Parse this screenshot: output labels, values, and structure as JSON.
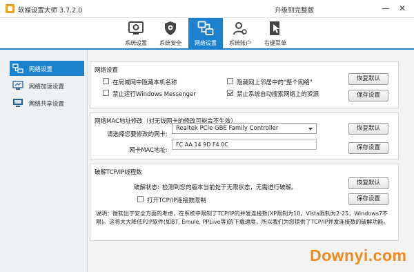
{
  "app": {
    "title": "软媒设置大师 3.7.2.0",
    "upgrade_label": "升级到完整版"
  },
  "window_controls": {
    "minimize": "—",
    "close": "✕"
  },
  "tabs": [
    {
      "label": "系统设置",
      "icon": "system-settings-icon"
    },
    {
      "label": "系统安全",
      "icon": "shield-gear-icon"
    },
    {
      "label": "网络设置",
      "icon": "network-icon",
      "active": true
    },
    {
      "label": "系统账户",
      "icon": "user-accounts-icon"
    },
    {
      "label": "右键菜单",
      "icon": "cursor-menu-icon"
    }
  ],
  "sidebar": {
    "items": [
      {
        "label": "网络设置",
        "icon": "network-settings-icon",
        "active": true
      },
      {
        "label": "网络加速设置",
        "icon": "network-speed-icon"
      },
      {
        "label": "网络共享设置",
        "icon": "network-share-icon"
      }
    ]
  },
  "network": {
    "title": "网络设置",
    "opt1": "在局域网中隐藏本机名称",
    "opt2": "隐藏网上邻居中的\"整个网络\"",
    "opt3": "禁止运行Windows Messenger",
    "opt4": "禁止系统自动搜索网络上的资源",
    "opt1_checked": false,
    "opt2_checked": false,
    "opt3_checked": false,
    "opt4_checked": true,
    "restore_label": "恢复默认",
    "save_label": "保存设置"
  },
  "mac": {
    "title": "网络MAC地址修改（对无线网卡的修改可能会不生效）",
    "card_label": "请选择您要修改的网卡:",
    "card_value": "Realtek PCIe GBE Family Controller",
    "mac_label": "网卡MAC地址:",
    "mac_value": "FC AA 14 9D F4 0C",
    "restore_label": "恢复默认",
    "save_label": "保存设置"
  },
  "tcp": {
    "title": "破解TCP/IP线程数",
    "status_label": "破解状态:",
    "status_text": "检测到您的版本当前处于无限状态，无需进行破解。",
    "toggle_label": "打开TCP/IP连接数限制",
    "toggle_checked": false,
    "note": "说明：微软出于安全方面的考虑，在系统中限制了TCP/IP的并发连接数(XP限制为10，Vista限制为2-25，Windows7不限)。这将大大降低P2P软件(如BT, Emule, PPLive等)的下载速度，所以我们为您提供了TCP/IP并发连接数的破解功能。",
    "restore_label": "恢复默认",
    "save_label": "保存设置"
  },
  "watermark": "Downyi.com",
  "colors": {
    "accent": "#1c82d0",
    "watermark": "#f08a1c"
  }
}
